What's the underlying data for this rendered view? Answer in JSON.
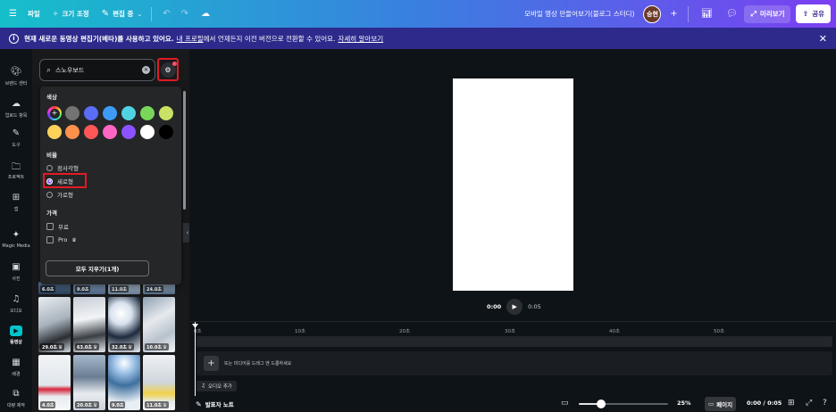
{
  "topbar": {
    "file_label": "파일",
    "resize_label": "크기 조정",
    "edit_label": "편집 중",
    "title": "모바일 영상 만들어보기(블로그 스터디)",
    "avatar_text": "승현",
    "preview_label": "미리보기",
    "share_label": "공유"
  },
  "notice": {
    "bold_text": "현재 새로운 동영상 편집기(베타)를 사용하고 있어요.",
    "link1": "내 프로필",
    "middle": "에서 언제든지 이전 버전으로 전환할 수 있어요.",
    "link2": "자세히 알아보기"
  },
  "rail": {
    "items": [
      {
        "label": "브랜드 센터",
        "icon": "brand-center-icon"
      },
      {
        "label": "업로드 항목",
        "icon": "upload-cloud-icon"
      },
      {
        "label": "도구",
        "icon": "draw-tools-icon"
      },
      {
        "label": "프로젝트",
        "icon": "folder-icon"
      },
      {
        "label": "앱",
        "icon": "apps-grid-icon"
      },
      {
        "label": "Magic Media",
        "icon": "magic-media-icon"
      },
      {
        "label": "사진",
        "icon": "photo-icon"
      },
      {
        "label": "오디오",
        "icon": "music-note-icon"
      },
      {
        "label": "동영상",
        "icon": "video-icon"
      },
      {
        "label": "배경",
        "icon": "background-pattern-icon"
      },
      {
        "label": "대량 제작",
        "icon": "bulk-create-icon"
      }
    ]
  },
  "search": {
    "value": "스노우보드"
  },
  "filters": {
    "color_title": "색상",
    "colors": [
      "#737373",
      "#5b6cf7",
      "#3d9bf6",
      "#4fd3e3",
      "#79d65a",
      "#c9e265",
      "#ffd25a",
      "#ff914d",
      "#ff5757",
      "#ff66c4",
      "#8c52ff",
      "#ffffff",
      "#000000"
    ],
    "ratio_title": "비율",
    "ratios": [
      {
        "label": "정사각형",
        "checked": false
      },
      {
        "label": "세로형",
        "checked": true
      },
      {
        "label": "가로형",
        "checked": false
      }
    ],
    "price_title": "가격",
    "prices": [
      {
        "label": "무료"
      },
      {
        "label": "Pro"
      }
    ],
    "clear_all_label": "모두 지우기(1개)"
  },
  "thumbs": {
    "row1": [
      "6.0초",
      "9.0초",
      "11.0초",
      "24.0초"
    ],
    "row2": [
      "29.0초",
      "63.0초",
      "32.0초",
      "10.0초"
    ],
    "row3": [
      "4.0초",
      "20.0초",
      "9.0초",
      "11.0초"
    ]
  },
  "playback": {
    "current": "0:00",
    "total": "0:05"
  },
  "timeline": {
    "ticks": [
      "0초",
      "10초",
      "20초",
      "30초",
      "40초",
      "50초"
    ],
    "drop_text": "또는 미디어를 드래그 앤 드롭하세요",
    "audio_label": "오디오 추가"
  },
  "bottombar": {
    "notes_label": "발표자 노트",
    "zoom": "25%",
    "zoom_fraction": 0.25,
    "page_label": "페이지",
    "time": "0:00 / 0:05"
  }
}
